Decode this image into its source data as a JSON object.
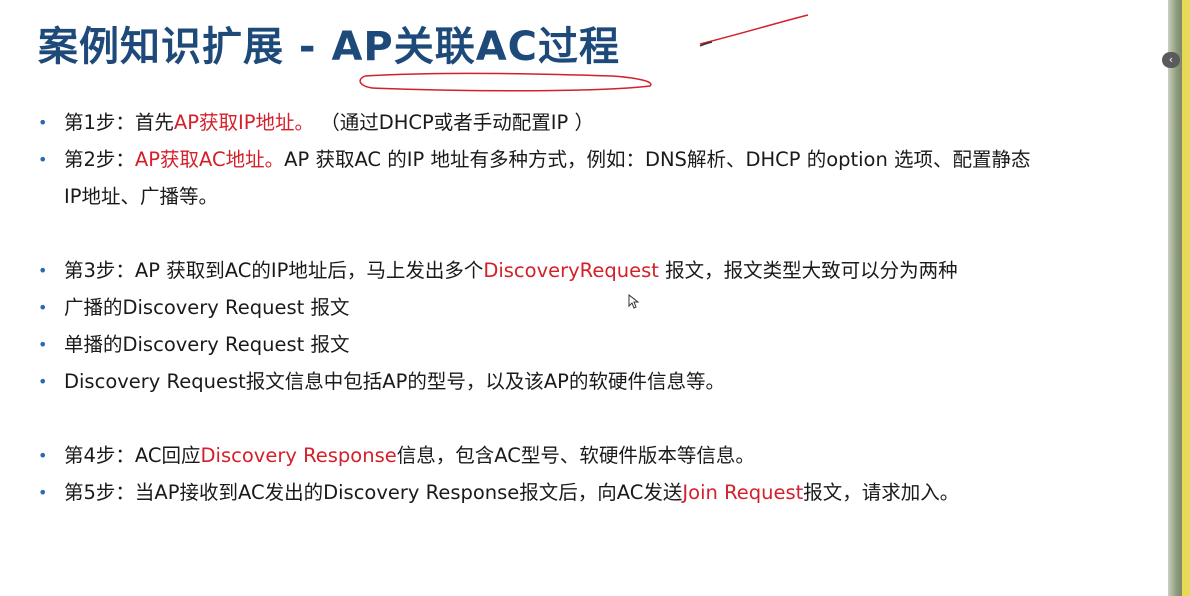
{
  "title": "案例知识扩展 - AP关联AC过程",
  "colors": {
    "title": "#1e4a7a",
    "highlight": "#d4202a",
    "bullet": "#2a6ab0"
  },
  "bullets": [
    {
      "parts": [
        "第1步：首先",
        "AP获取IP地址。",
        " （通过DHCP或者手动配置IP ）"
      ]
    },
    {
      "parts": [
        "第2步：",
        "AP获取AC地址。",
        "AP 获取AC 的IP 地址有多种方式，例如：DNS解析、DHCP 的option 选项、配置静态",
        "IP地址、广播等。"
      ]
    },
    {
      "parts": [
        "第3步：AP 获取到AC的IP地址后，马上发出多个",
        "DiscoveryRequest",
        " 报文，报文类型大致可以分为两种"
      ]
    },
    {
      "parts": [
        "广播的Discovery Request 报文"
      ]
    },
    {
      "parts": [
        "单播的Discovery Request 报文"
      ]
    },
    {
      "parts": [
        "Discovery Request报文信息中包括AP的型号，以及该AP的软硬件信息等。"
      ]
    },
    {
      "parts": [
        "第4步：AC回应",
        "Discovery Response",
        "信息，包含AC型号、软硬件版本等信息。"
      ]
    },
    {
      "parts": [
        "第5步：当AP接收到AC发出的Discovery Response报文后，向AC发送",
        "Join  Request",
        "报文，请求加入。"
      ]
    }
  ],
  "icons": [
    "bullet-dot-icon",
    "mouse-cursor-icon",
    "chevron-left-icon",
    "pen-annotation-icon"
  ]
}
